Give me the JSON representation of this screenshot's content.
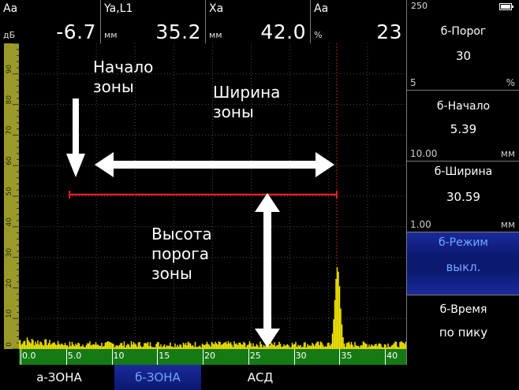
{
  "readouts": [
    {
      "label": "Aa",
      "unit": "дБ",
      "value": "-6.7"
    },
    {
      "label": "Ya,L1",
      "unit": "мм",
      "value": "35.2"
    },
    {
      "label": "Xa",
      "unit": "мм",
      "value": "42.0"
    },
    {
      "label": "Aa",
      "unit": "%",
      "value": "23"
    }
  ],
  "side": {
    "header_value": "250",
    "panels": [
      {
        "title": "б-Порог",
        "value": "30",
        "low": "5",
        "unit": "%"
      },
      {
        "title": "б-Начало",
        "value": "5.39",
        "low": "10.00",
        "unit": "мм"
      },
      {
        "title": "б-Ширина",
        "value": "30.59",
        "low": "1.00",
        "unit": "мм"
      },
      {
        "title": "б-Режим",
        "value": "выкл."
      },
      {
        "title": "б-Время",
        "value": "по пику"
      }
    ]
  },
  "annotations": {
    "start": "Начало\nзоны",
    "width": "Ширина\nзоны",
    "height": "Высота\nпорога\nзоны"
  },
  "x_ticks": [
    "0.0",
    "5.0",
    "10",
    "15",
    "20",
    "25",
    "30",
    "35",
    "40"
  ],
  "y_ticks": [
    "0",
    "10",
    "20",
    "30",
    "40",
    "50",
    "60",
    "70",
    "80",
    "90"
  ],
  "tabs": [
    "а-ЗОНА",
    "б-ЗОНА",
    "АСД"
  ],
  "colors": {
    "gate": "#e0201c",
    "signal": "#f2e600",
    "axis": "#147a14",
    "active": "#0b1870"
  }
}
